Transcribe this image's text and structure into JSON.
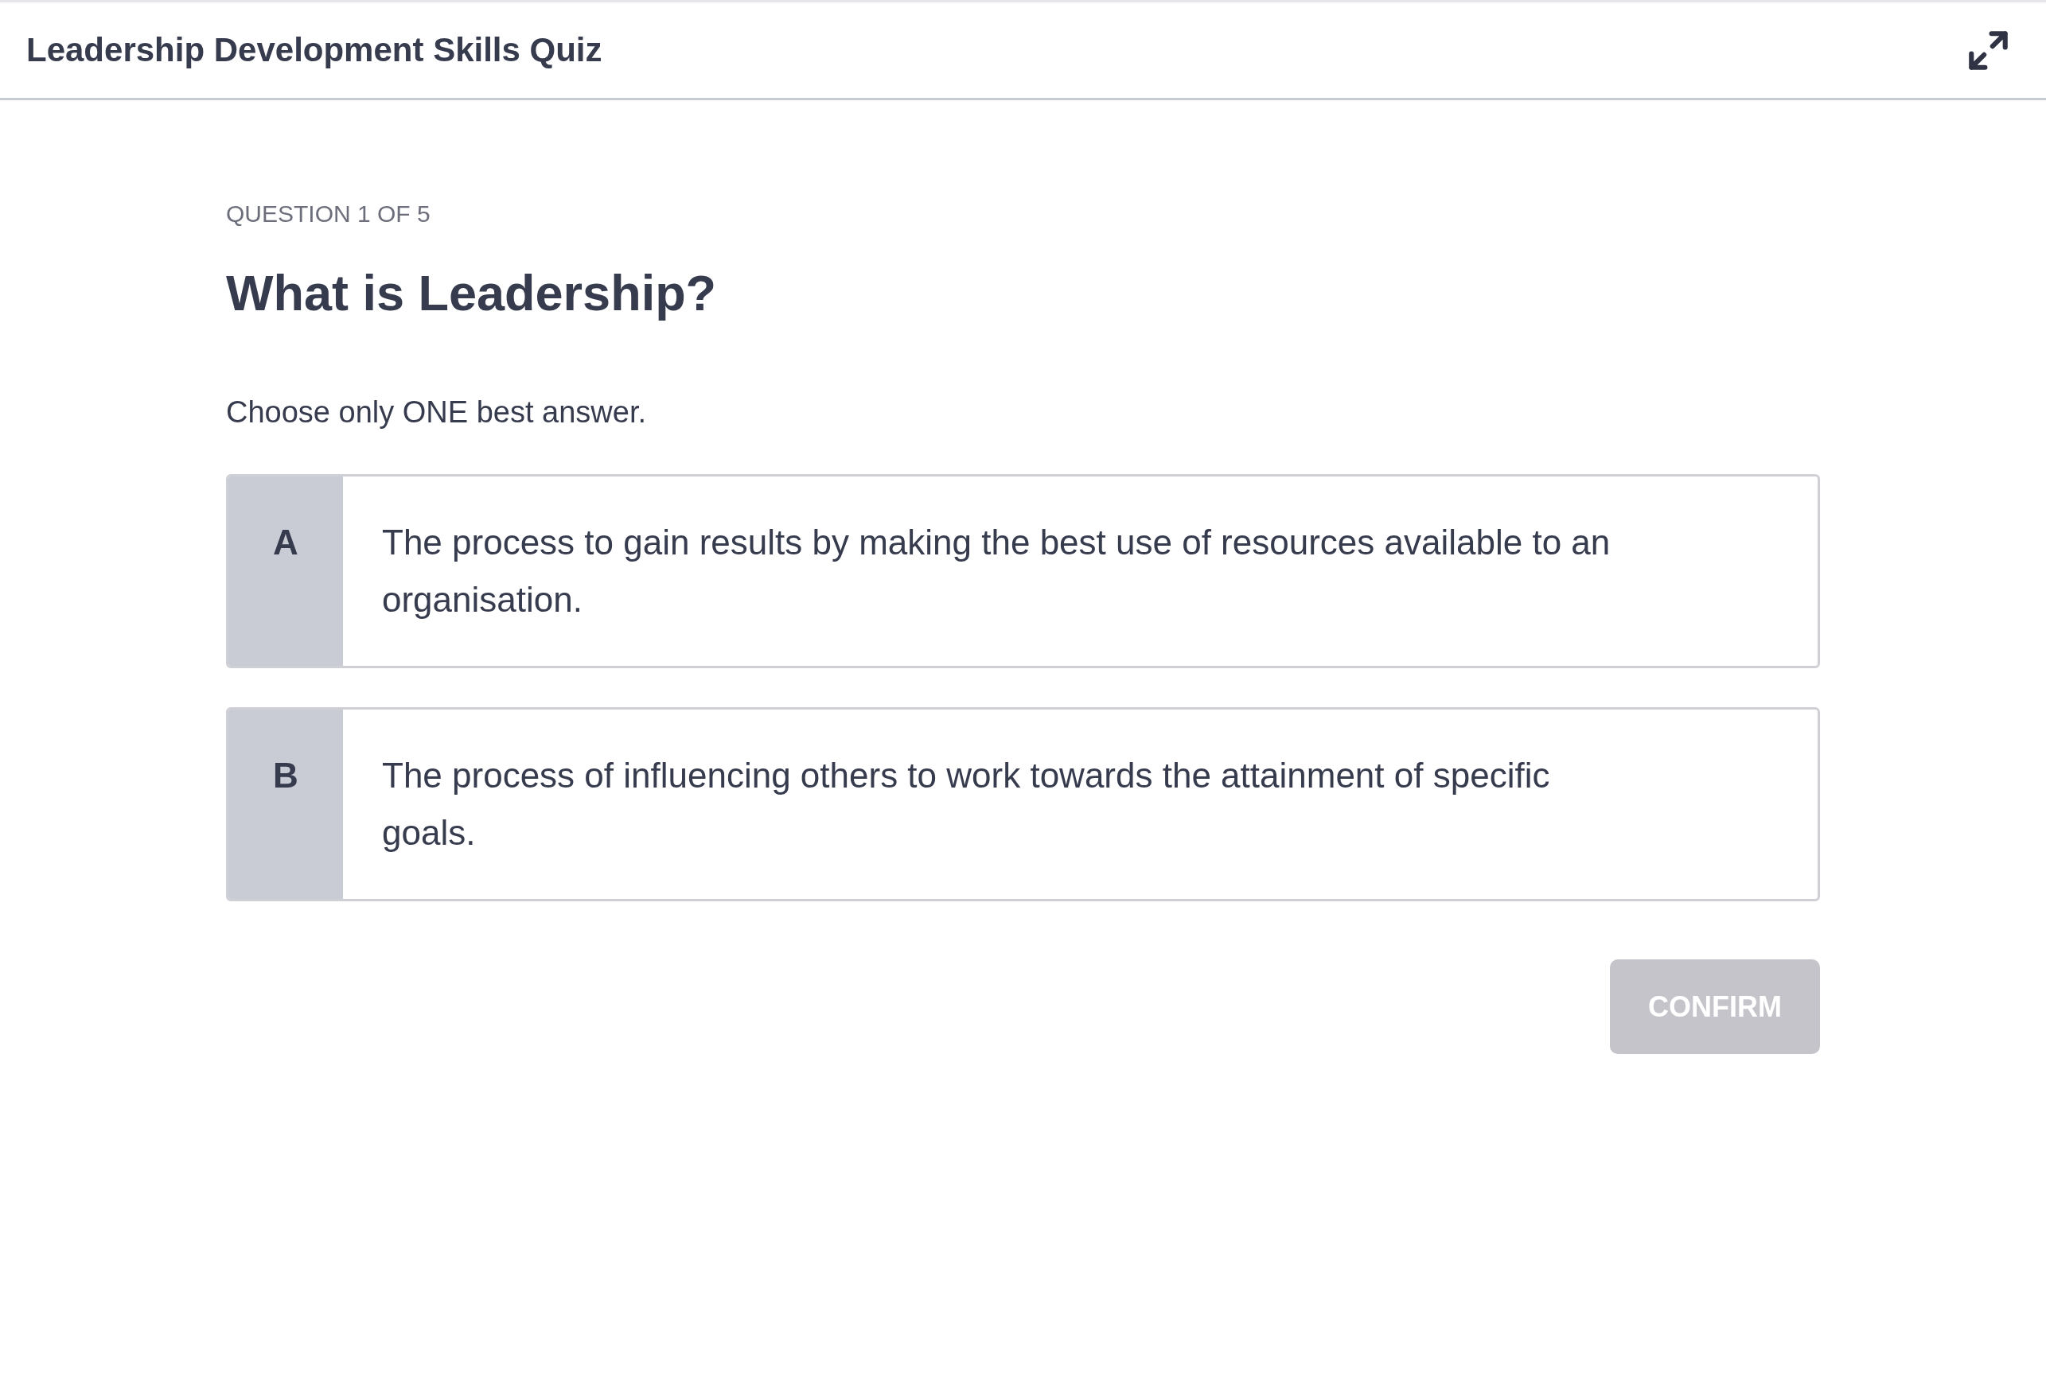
{
  "header": {
    "title": "Leadership Development Skills Quiz"
  },
  "question": {
    "progress": "QUESTION 1 OF 5",
    "title": "What is Leadership?",
    "instruction": "Choose only ONE best answer."
  },
  "options": [
    {
      "letter": "A",
      "text": "The process to gain results by making the best use of resources available to an organisation.",
      "selected": false
    },
    {
      "letter": "B",
      "text": "The process of influencing others to work towards the attainment of specific goals.",
      "selected": false
    }
  ],
  "confirm_button": {
    "label": "CONFIRM",
    "disabled": true
  }
}
